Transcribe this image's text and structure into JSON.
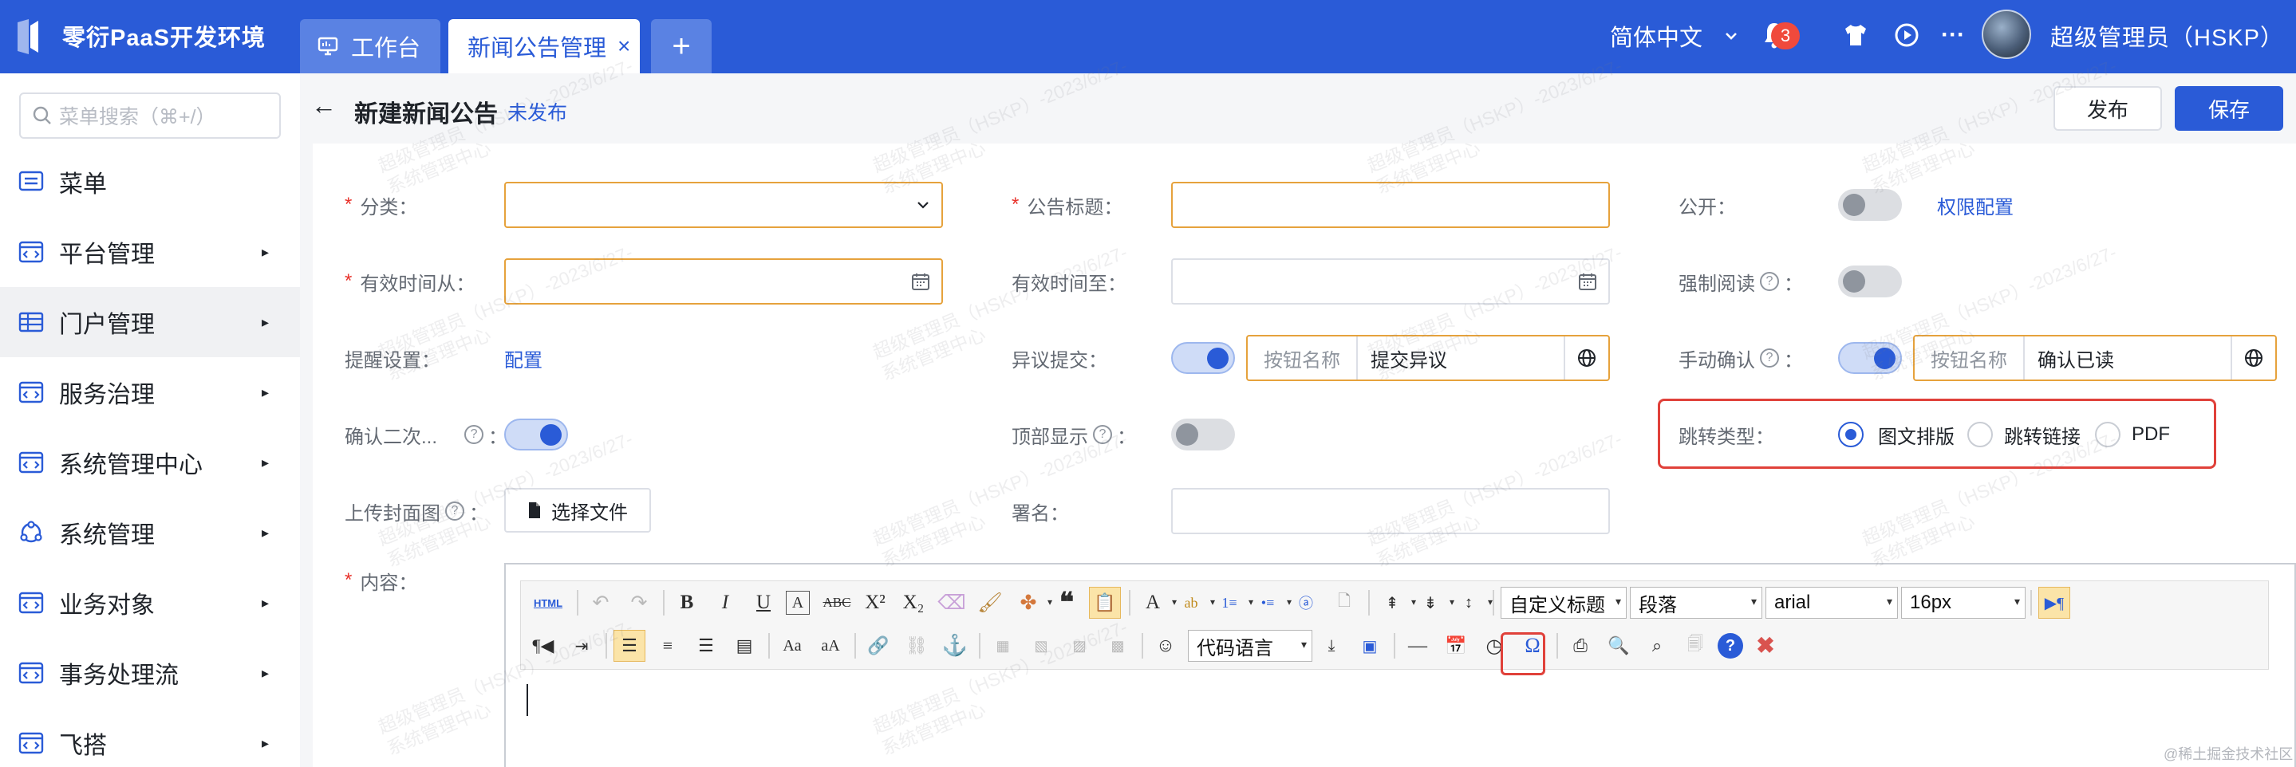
{
  "app": {
    "title": "零衍PaaS开发环境"
  },
  "tabs": [
    {
      "label": "工作台"
    },
    {
      "label": "新闻公告管理",
      "close": "×"
    }
  ],
  "tab_add": "+",
  "header": {
    "language": "简体中文",
    "notification_count": "3",
    "more": "···",
    "user_name": "超级管理员（HSKP）"
  },
  "sidebar": {
    "search_placeholder": "菜单搜索（⌘+/）",
    "items": [
      {
        "label": "菜单",
        "icon": "menu-icon",
        "arrow": ""
      },
      {
        "label": "平台管理",
        "icon": "code-box-icon",
        "arrow": "▸"
      },
      {
        "label": "门户管理",
        "icon": "table-icon",
        "arrow": "▸"
      },
      {
        "label": "服务治理",
        "icon": "code-box-icon",
        "arrow": "▸"
      },
      {
        "label": "系统管理中心",
        "icon": "code-box-icon",
        "arrow": "▸"
      },
      {
        "label": "系统管理",
        "icon": "network-icon",
        "arrow": "▸"
      },
      {
        "label": "业务对象",
        "icon": "code-box-icon",
        "arrow": "▸"
      },
      {
        "label": "事务处理流",
        "icon": "code-box-icon",
        "arrow": "▸"
      },
      {
        "label": "飞搭",
        "icon": "code-box-icon",
        "arrow": "▸"
      }
    ]
  },
  "page": {
    "back": "←",
    "title": "新建新闻公告",
    "status": "未发布",
    "publish": "发布",
    "save": "保存"
  },
  "form": {
    "category_label": "分类：",
    "title_label": "公告标题：",
    "public_label": "公开：",
    "permission_link": "权限配置",
    "valid_from_label": "有效时间从：",
    "valid_to_label": "有效时间至：",
    "force_read_label": "强制阅读",
    "reminder_label": "提醒设置：",
    "reminder_link": "配置",
    "objection_label": "异议提交：",
    "objection_btn_prefix": "按钮名称",
    "objection_btn_value": "提交异议",
    "manual_confirm_label": "手动确认",
    "confirm_btn_prefix": "按钮名称",
    "confirm_btn_value": "确认已读",
    "confirm_twice_label": "确认二次...",
    "top_display_label": "顶部显示",
    "jump_type_label": "跳转类型：",
    "jump_options": [
      "图文排版",
      "跳转链接",
      "PDF"
    ],
    "cover_label": "上传封面图",
    "upload_button": "选择文件",
    "signature_label": "署名：",
    "content_label": "内容：",
    "colon": "："
  },
  "editor": {
    "html_button": "HTML",
    "custom_title": "自定义标题",
    "paragraph": "段落",
    "font_family": "arial",
    "font_size": "16px",
    "code_language": "代码语言"
  },
  "watermark": {
    "line1": "超级管理员（HSKP）-2023/6/27-",
    "line2": "系统管理中心"
  },
  "credit": "@稀土掘金技术社区",
  "colors": {
    "brand": "#2a5bd7",
    "warning_border": "#e6a23c",
    "highlight_red": "#e0413a"
  }
}
